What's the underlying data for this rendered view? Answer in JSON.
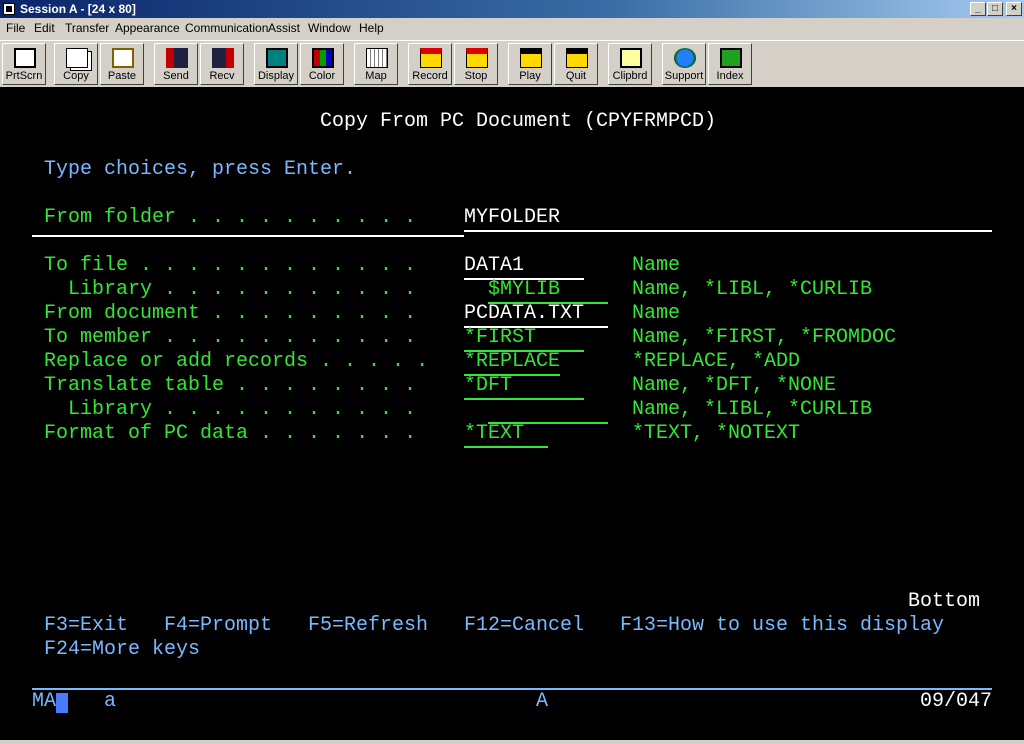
{
  "window": {
    "title": "Session A - [24 x 80]",
    "controls": [
      "_",
      "□",
      "×"
    ]
  },
  "menu": [
    "File",
    "Edit",
    "Transfer",
    "Appearance",
    "Communication",
    "Assist",
    "Window",
    "Help"
  ],
  "toolbar": [
    {
      "label": "PrtScrn",
      "icon": "printer-icon"
    },
    {
      "label": "Copy",
      "icon": "copy-icon"
    },
    {
      "label": "Paste",
      "icon": "paste-icon"
    },
    {
      "label": "Send",
      "icon": "send-icon"
    },
    {
      "label": "Recv",
      "icon": "receive-icon"
    },
    {
      "label": "Display",
      "icon": "display-icon"
    },
    {
      "label": "Color",
      "icon": "color-icon"
    },
    {
      "label": "Map",
      "icon": "keyboard-map-icon"
    },
    {
      "label": "Record",
      "icon": "record-icon"
    },
    {
      "label": "Stop",
      "icon": "stop-icon"
    },
    {
      "label": "Play",
      "icon": "play-icon"
    },
    {
      "label": "Quit",
      "icon": "quit-icon"
    },
    {
      "label": "Clipbrd",
      "icon": "clipboard-icon"
    },
    {
      "label": "Support",
      "icon": "support-globe-icon"
    },
    {
      "label": "Index",
      "icon": "index-book-icon"
    }
  ],
  "screen": {
    "title": "Copy From PC Document (CPYFRMPCD)",
    "instruction": "Type choices, press Enter.",
    "from_folder": {
      "label": "From folder",
      "value": "MYFOLDER"
    },
    "params": [
      {
        "label": "To file",
        "value": "DATA1",
        "help": "Name"
      },
      {
        "label": "Library",
        "value": "$MYLIB",
        "help": "Name, *LIBL, *CURLIB"
      },
      {
        "label": "From document",
        "value": "PCDATA.TXT",
        "help": "Name"
      },
      {
        "label": "To member",
        "value": "*FIRST",
        "help": "Name, *FIRST, *FROMDOC"
      },
      {
        "label": "Replace or add records",
        "value": "*REPLACE",
        "help": "*REPLACE, *ADD"
      },
      {
        "label": "Translate table",
        "value": "*DFT",
        "help": "Name, *DFT, *NONE"
      },
      {
        "label": "Library",
        "value": "",
        "help": "Name, *LIBL, *CURLIB"
      },
      {
        "label": "Format of PC data",
        "value": "*TEXT",
        "help": "*TEXT, *NOTEXT"
      }
    ],
    "more_indicator": "Bottom",
    "function_keys": [
      "F3=Exit",
      "F4=Prompt",
      "F5=Refresh",
      "F12=Cancel",
      "F13=How to use this display"
    ],
    "function_keys_2": "F24=More keys",
    "status": {
      "session": "MA",
      "mode": "a",
      "keyboard": "A",
      "cursor_pos": "09/047"
    }
  }
}
